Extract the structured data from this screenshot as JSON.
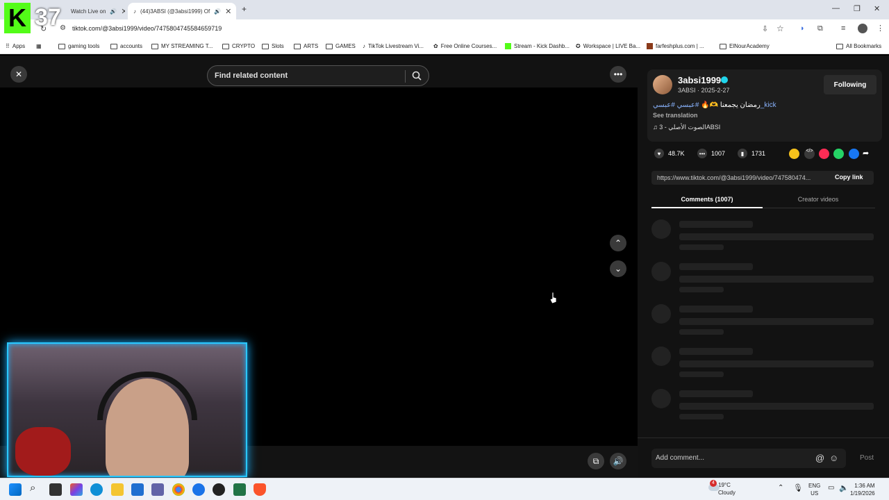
{
  "browser": {
    "tabs": [
      {
        "label": "Watch Live on"
      },
      {
        "label": "(44)3ABSI (@3absi1999) Of"
      }
    ],
    "url": "tiktok.com/@3absi1999/video/7475804745584659719",
    "bookmarks": [
      "Apps",
      "gaming tools",
      "accounts",
      "MY STREAMING T...",
      "CRYPTO",
      "Slots",
      "ARTS",
      "GAMES",
      "TikTok Livestream Vi...",
      "Free Online Courses...",
      "Stream - Kick Dashb...",
      "Workspace | LIVE Ba...",
      "farfeshplus.com | ...",
      "ElNourAcademy",
      "All Bookmarks"
    ]
  },
  "overlay": {
    "kick_letter": "K",
    "viewer_count": "37"
  },
  "video": {
    "search_placeholder": "Find related content"
  },
  "panel": {
    "username": "3absi1999",
    "subline": "3ABSI · 2025-2-27",
    "follow_label": "Following",
    "caption_text": "رمضان يجمعنا 🫶🔥 ",
    "caption_tags": "#عبسي #عبسي_kick",
    "see_translation": "See translation",
    "music": "♫ الصوت الأصلي - 3ABSI",
    "likes": "48.7K",
    "comments": "1007",
    "saves": "1731",
    "link": "https://www.tiktok.com/@3absi1999/video/747580474...",
    "copy_label": "Copy link",
    "tab_comments": "Comments (1007)",
    "tab_creator": "Creator videos",
    "comment_placeholder": "Add comment...",
    "post_label": "Post"
  },
  "taskbar": {
    "weather_temp": "19°C",
    "weather_desc": "Cloudy",
    "weather_badge": "4",
    "lang_1": "ENG",
    "lang_2": "US",
    "time": "1:36 AM",
    "date": "1/19/2026"
  },
  "colors": {
    "accent_cyan": "#29c8ff",
    "kick_green": "#53fc18",
    "verified": "#20d5ec"
  }
}
